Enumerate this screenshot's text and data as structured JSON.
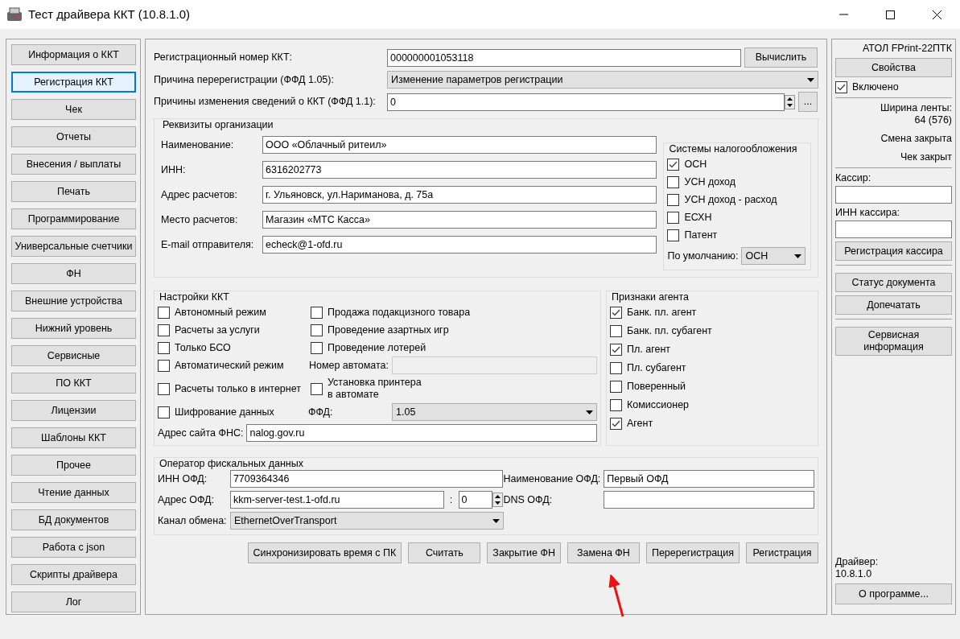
{
  "window": {
    "title": "Тест драйвера ККТ (10.8.1.0)"
  },
  "sidebar": {
    "items": [
      {
        "label": "Информация о ККТ",
        "selected": false
      },
      {
        "label": "Регистрация ККТ",
        "selected": true
      },
      {
        "label": "Чек",
        "selected": false
      },
      {
        "label": "Отчеты",
        "selected": false
      },
      {
        "label": "Внесения / выплаты",
        "selected": false
      },
      {
        "label": "Печать",
        "selected": false
      },
      {
        "label": "Программирование",
        "selected": false
      },
      {
        "label": "Универсальные счетчики",
        "selected": false
      },
      {
        "label": "ФН",
        "selected": false
      },
      {
        "label": "Внешние устройства",
        "selected": false
      },
      {
        "label": "Нижний уровень",
        "selected": false
      },
      {
        "label": "Сервисные",
        "selected": false
      },
      {
        "label": "ПО ККТ",
        "selected": false
      },
      {
        "label": "Лицензии",
        "selected": false
      },
      {
        "label": "Шаблоны ККТ",
        "selected": false
      },
      {
        "label": "Прочее",
        "selected": false
      },
      {
        "label": "Чтение данных",
        "selected": false
      },
      {
        "label": "БД документов",
        "selected": false
      },
      {
        "label": "Работа с json",
        "selected": false
      },
      {
        "label": "Скрипты драйвера",
        "selected": false
      },
      {
        "label": "Лог",
        "selected": false
      }
    ]
  },
  "registration": {
    "reg_number": {
      "label": "Регистрационный номер ККТ:",
      "value": "000000001053118"
    },
    "calc_button": "Вычислить",
    "reason": {
      "label": "Причина перерегистрации (ФФД 1.05):",
      "value": "Изменение параметров регистрации"
    },
    "change_reasons": {
      "label": "Причины изменения сведений о ККТ (ФФД 1.1):",
      "value": "0"
    },
    "more_button": "..."
  },
  "organization": {
    "title": "Реквизиты организации",
    "fields": [
      {
        "label": "Наименование:",
        "value": "ООО «Облачный ритеил»"
      },
      {
        "label": "ИНН:",
        "value": "6316202773"
      },
      {
        "label": "Адрес расчетов:",
        "value": "г. Ульяновск, ул.Нариманова, д. 75а"
      },
      {
        "label": "Место расчетов:",
        "value": "Магазин «МТС Касса»"
      },
      {
        "label": "E-mail отправителя:",
        "value": "echeck@1-ofd.ru"
      }
    ],
    "tax": {
      "title": "Системы налогообложения",
      "options": [
        {
          "label": "ОСН",
          "checked": true
        },
        {
          "label": "УСН доход",
          "checked": false
        },
        {
          "label": "УСН доход - расход",
          "checked": false
        },
        {
          "label": "ЕСХН",
          "checked": false
        },
        {
          "label": "Патент",
          "checked": false
        }
      ],
      "default": {
        "label": "По умолчанию:",
        "value": "ОСН"
      }
    }
  },
  "settings": {
    "title": "Настройки ККТ",
    "rows": [
      {
        "left": {
          "label": "Автономный режим",
          "checked": false
        },
        "right": {
          "kind": "checkbox",
          "label": "Продажа подакцизного товара",
          "checked": false
        }
      },
      {
        "left": {
          "label": "Расчеты за услуги",
          "checked": false
        },
        "right": {
          "kind": "checkbox",
          "label": "Проведение азартных игр",
          "checked": false
        }
      },
      {
        "left": {
          "label": "Только БСО",
          "checked": false
        },
        "right": {
          "kind": "checkbox",
          "label": "Проведение лотерей",
          "checked": false
        }
      },
      {
        "left": {
          "label": "Автоматический режим",
          "checked": false
        },
        "right": {
          "kind": "field",
          "label": "Номер автомата:"
        }
      },
      {
        "left": {
          "label": "Расчеты только в интернет",
          "checked": false
        },
        "right": {
          "kind": "checkbox",
          "label": "Установка принтера\nв автомате",
          "checked": false
        }
      },
      {
        "left": {
          "label": "Шифрование данных",
          "checked": false
        },
        "right": {
          "kind": "select",
          "label": "ФФД:",
          "value": "1.05"
        }
      }
    ],
    "fns_site": {
      "label": "Адрес сайта ФНС:",
      "value": "nalog.gov.ru"
    }
  },
  "agent": {
    "title": "Признаки агента",
    "options": [
      {
        "label": "Банк. пл. агент",
        "checked": true
      },
      {
        "label": "Банк. пл. субагент",
        "checked": false
      },
      {
        "label": "Пл. агент",
        "checked": true
      },
      {
        "label": "Пл. субагент",
        "checked": false
      },
      {
        "label": "Поверенный",
        "checked": false
      },
      {
        "label": "Комиссионер",
        "checked": false
      },
      {
        "label": "Агент",
        "checked": true
      }
    ]
  },
  "ofd": {
    "title": "Оператор фискальных данных",
    "inn": {
      "label": "ИНН ОФД:",
      "value": "7709364346"
    },
    "name": {
      "label": "Наименование ОФД:",
      "value": "Первый ОФД"
    },
    "address": {
      "label": "Адрес ОФД:",
      "value": "kkm-server-test.1-ofd.ru"
    },
    "port": {
      "label": ":",
      "value": "0"
    },
    "dns": {
      "label": "DNS ОФД:"
    },
    "channel": {
      "label": "Канал обмена:",
      "value": "EthernetOverTransport"
    }
  },
  "actions": [
    "Синхронизировать время с ПК",
    "Считать",
    "Закрытие ФН",
    "Замена ФН",
    "Перерегистрация",
    "Регистрация"
  ],
  "device": {
    "model": "АТОЛ FPrint-22ПТК",
    "properties_button": "Свойства",
    "enabled": {
      "label": "Включено",
      "checked": true
    },
    "tape_width": {
      "label": "Ширина ленты:",
      "value": "64 (576)"
    },
    "shift_status": "Смена закрыта",
    "receipt_status": "Чек закрыт",
    "cashier": {
      "label": "Кассир:"
    },
    "cashier_inn": {
      "label": "ИНН кассира:"
    },
    "button_groups": [
      [
        "Регистрация кассира"
      ],
      [
        "Статус документа",
        "Допечатать"
      ],
      [
        "Сервисная информация"
      ]
    ],
    "driver_label": "Драйвер:",
    "driver_version": "10.8.1.0",
    "about_button": "О программе..."
  }
}
